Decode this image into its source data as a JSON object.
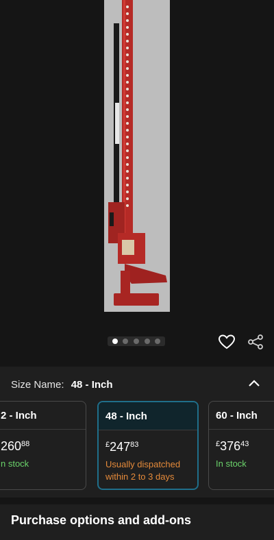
{
  "gallery": {
    "image_alt": "Red high-lift farm jack",
    "dots_total": 5,
    "active_dot": 0
  },
  "icons": {
    "wishlist": "heart-icon",
    "share": "share-icon",
    "collapse": "chevron-up-icon"
  },
  "size": {
    "label": "Size Name:",
    "selected": "48 - Inch"
  },
  "options": [
    {
      "title": "2 - Inch",
      "currency": "",
      "whole": "260",
      "fraction": "88",
      "status": "n stock",
      "status_color": "#6bd36b"
    },
    {
      "title": "48 - Inch",
      "currency": "£",
      "whole": "247",
      "fraction": "83",
      "status": "Usually dispatched within 2 to 3 days",
      "status_color": "#e58a3a"
    },
    {
      "title": "60 - Inch",
      "currency": "£",
      "whole": "376",
      "fraction": "43",
      "status": "In stock",
      "status_color": "#6bd36b"
    }
  ],
  "purchase": {
    "title": "Purchase options and add-ons"
  },
  "colors": {
    "selected_border": "#1f6f8b",
    "background": "#151515",
    "sheet": "#1f1f1f"
  }
}
